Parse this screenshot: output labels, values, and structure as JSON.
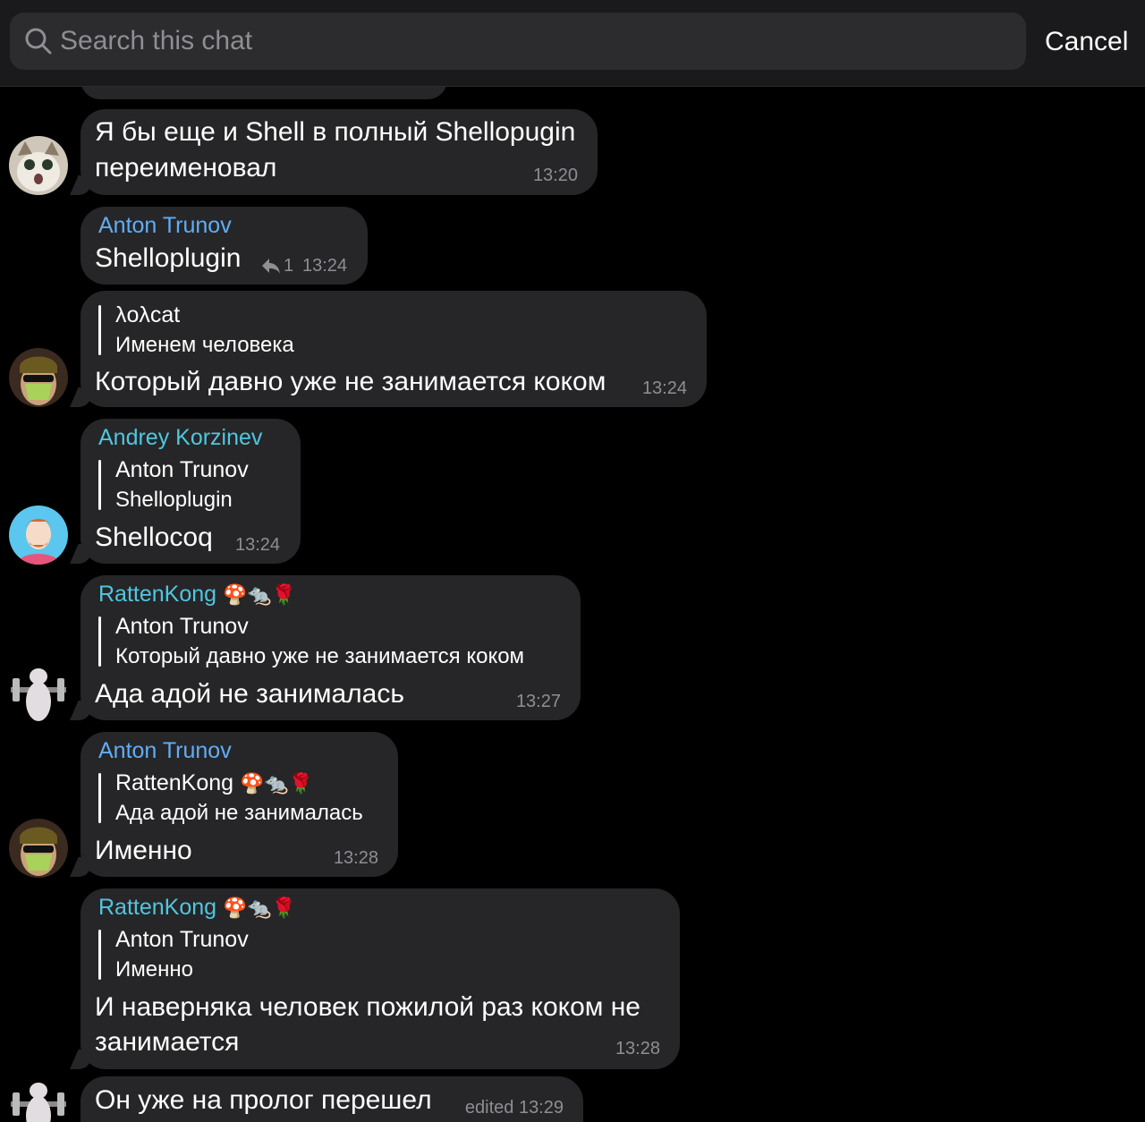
{
  "search": {
    "placeholder": "Search this chat",
    "cancel_label": "Cancel"
  },
  "colors": {
    "background": "#000000",
    "bubble": "#262628",
    "blue_name": "#61aef5",
    "cyan_name": "#4fc7e0"
  },
  "messages": [
    {
      "text": "Я бы еще и Shell в полный Shellopugin переименовал",
      "line1": "Я бы еще и Shell в полный Shellopugin",
      "line2": "переименовал",
      "time": "13:20"
    },
    {
      "sender": "Anton Trunov",
      "text": "Shelloplugin",
      "replies": "1",
      "time": "13:24"
    },
    {
      "reply_name": "λoλcat",
      "reply_text": "Именем человека",
      "text": "Который давно уже не занимается коком",
      "time": "13:24"
    },
    {
      "sender": "Andrey Korzinev",
      "reply_name": "Anton Trunov",
      "reply_text": "Shelloplugin",
      "text": "Shellocoq",
      "time": "13:24"
    },
    {
      "sender": "RattenKong",
      "sender_emoji": "🍄🐀🌹",
      "reply_name": "Anton Trunov",
      "reply_text": "Который давно уже не занимается коком",
      "text": "Ада адой не занималась",
      "time": "13:27"
    },
    {
      "sender": "Anton Trunov",
      "reply_name": "RattenKong",
      "reply_emoji": "🍄🐀🌹",
      "reply_text": "Ада адой не занималась",
      "text": "Именно",
      "time": "13:28"
    },
    {
      "sender": "RattenKong",
      "sender_emoji": "🍄🐀🌹",
      "reply_name": "Anton Trunov",
      "reply_text": "Именно",
      "line1": "И наверняка человек пожилой раз коком не",
      "line2": "занимается",
      "time": "13:28"
    },
    {
      "text": "Он уже на пролог перешел",
      "time": "edited 13:29"
    }
  ]
}
